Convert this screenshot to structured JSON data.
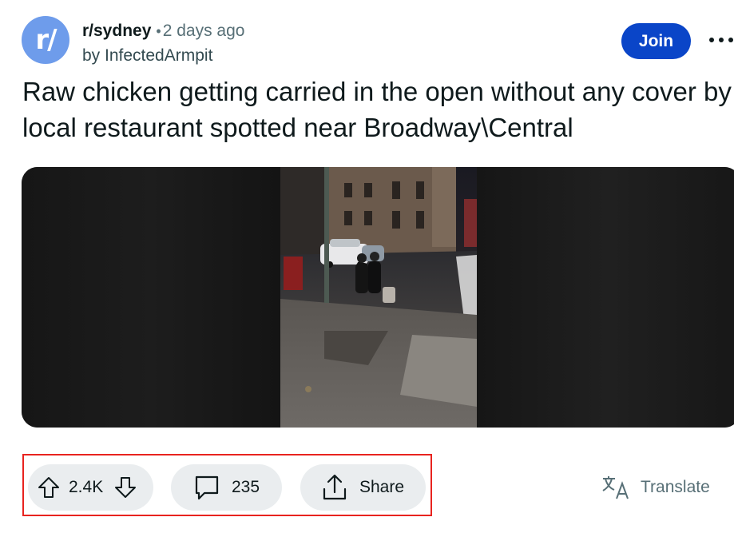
{
  "post": {
    "avatar_text": "r/",
    "subreddit": "r/sydney",
    "separator": "•",
    "time": "2 days ago",
    "author": "by InfectedArmpit",
    "join_label": "Join",
    "title": "Raw chicken getting carried in the open without any cover by local restaurant spotted near Broadway\\Central"
  },
  "actions": {
    "upvotes": "2.4K",
    "comments": "235",
    "share_label": "Share",
    "translate_label": "Translate"
  },
  "colors": {
    "join": "#0a45c8",
    "avatar": "#6e9ceb",
    "highlight_box": "#e8231f",
    "pill_bg": "#eaedef"
  },
  "icons": [
    "more-icon",
    "upvote-icon",
    "downvote-icon",
    "comment-icon",
    "share-icon",
    "translate-icon"
  ]
}
